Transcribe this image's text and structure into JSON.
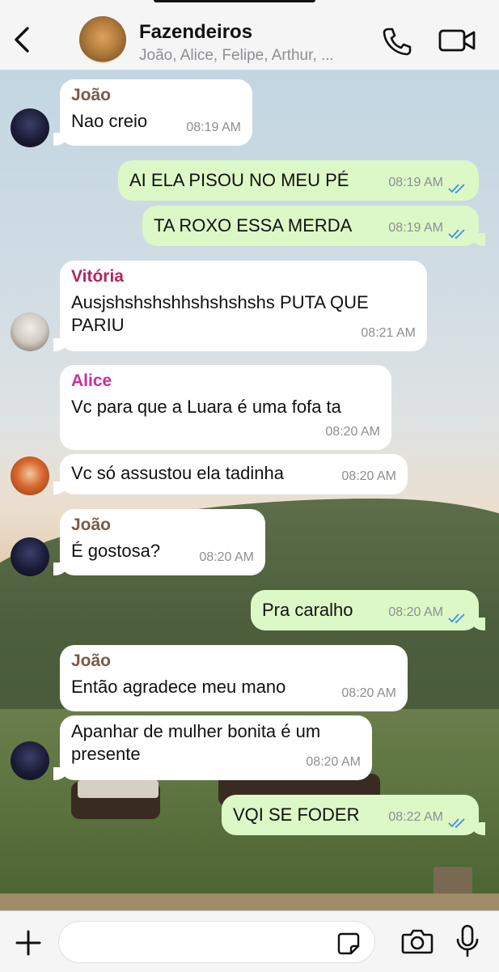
{
  "header": {
    "group_name": "Fazendeiros",
    "members": "João, Alice, Felipe, Arthur, ..."
  },
  "colors": {
    "joao": "#7a5a46",
    "vitoria": "#b5245f",
    "alice": "#c92f9e",
    "read_ticks": "#3f8ee0"
  },
  "messages": [
    {
      "sender": "João",
      "text": "Nao creio",
      "time": "08:19 AM"
    },
    {
      "text": "AI ELA PISOU NO MEU PÉ",
      "time": "08:19 AM"
    },
    {
      "text": "TA ROXO ESSA MERDA",
      "time": "08:19 AM"
    },
    {
      "sender": "Vitória",
      "text": "Ausjshshshshhshshshshs PUTA QUE PARIU",
      "time": "08:21 AM"
    },
    {
      "sender": "Alice",
      "text": "Vc para que a Luara é uma fofa ta",
      "time": "08:20 AM"
    },
    {
      "text": "Vc só assustou ela tadinha",
      "time": "08:20 AM"
    },
    {
      "sender": "João",
      "text": "É gostosa?",
      "time": "08:20 AM"
    },
    {
      "text": "Pra caralho",
      "time": "08:20 AM"
    },
    {
      "sender": "João",
      "text": "Então agradece meu mano",
      "time": "08:20 AM"
    },
    {
      "text": "Apanhar de mulher bonita é um presente",
      "time": "08:20 AM"
    },
    {
      "text": "VQI SE FODER",
      "time": "08:22 AM"
    }
  ],
  "composer": {
    "placeholder": ""
  },
  "icons": [
    "chevron-left-icon",
    "phone-icon",
    "video-camera-icon",
    "plus-icon",
    "sticker-icon",
    "camera-icon",
    "microphone-icon",
    "double-check-icon"
  ]
}
